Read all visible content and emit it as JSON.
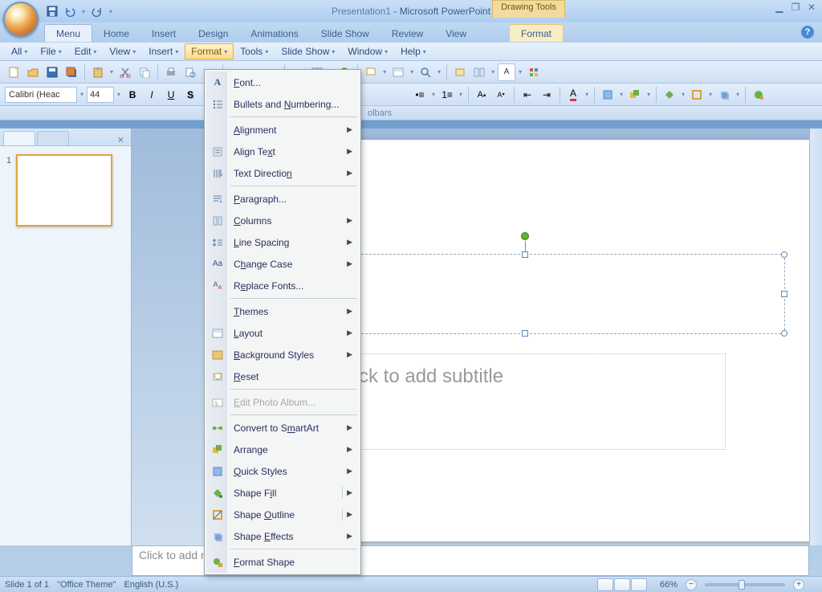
{
  "title": {
    "filename": "Presentation1",
    "app": "Microsoft PowerPoint",
    "context_tab": "Drawing Tools"
  },
  "ribbon_tabs": [
    "Menu",
    "Home",
    "Insert",
    "Design",
    "Animations",
    "Slide Show",
    "Review",
    "View"
  ],
  "ribbon_context_tab": "Format",
  "classic_menu": [
    "All",
    "File",
    "Edit",
    "View",
    "Insert",
    "Format",
    "Tools",
    "Slide Show",
    "Window",
    "Help"
  ],
  "classic_menu_open_index": 5,
  "font": {
    "name": "Calibri (Heac",
    "size": "44"
  },
  "toolbar_expand_label": "olbars",
  "format_menu": [
    {
      "label_html": "<u>F</u>ont...",
      "icon": "A",
      "type": "item"
    },
    {
      "label_html": "Bullets and <u>N</u>umbering...",
      "icon": "list",
      "type": "item"
    },
    {
      "type": "sep"
    },
    {
      "label_html": "<u>A</u>lignment",
      "icon": "",
      "type": "sub"
    },
    {
      "label_html": "Align Te<u>x</u>t",
      "icon": "align-text",
      "type": "sub"
    },
    {
      "label_html": "Text Directio<u>n</u>",
      "icon": "text-dir",
      "type": "sub"
    },
    {
      "type": "sep"
    },
    {
      "label_html": "<u>P</u>aragraph...",
      "icon": "para",
      "type": "item"
    },
    {
      "label_html": "<u>C</u>olumns",
      "icon": "cols",
      "type": "sub"
    },
    {
      "label_html": "<u>L</u>ine Spacing",
      "icon": "linesp",
      "type": "sub"
    },
    {
      "label_html": "C<u>h</u>ange Case",
      "icon": "Aa",
      "type": "sub"
    },
    {
      "label_html": "R<u>e</u>place Fonts...",
      "icon": "repfont",
      "type": "item"
    },
    {
      "type": "sep"
    },
    {
      "label_html": "<u>T</u>hemes",
      "icon": "",
      "type": "sub"
    },
    {
      "label_html": "<u>L</u>ayout",
      "icon": "layout",
      "type": "sub"
    },
    {
      "label_html": "<u>B</u>ackground Styles",
      "icon": "bg",
      "type": "sub"
    },
    {
      "label_html": "<u>R</u>eset",
      "icon": "reset",
      "type": "item"
    },
    {
      "type": "sep"
    },
    {
      "label_html": "<u>E</u>dit Photo Album...",
      "icon": "photo",
      "type": "item",
      "disabled": true
    },
    {
      "type": "sep"
    },
    {
      "label_html": "Convert to S<u>m</u>artArt",
      "icon": "smart",
      "type": "sub"
    },
    {
      "label_html": "Arran<u>g</u>e",
      "icon": "arrange",
      "type": "sub"
    },
    {
      "label_html": "<u>Q</u>uick Styles",
      "icon": "qstyle",
      "type": "sub"
    },
    {
      "label_html": "Shape F<u>i</u>ll",
      "icon": "fill",
      "type": "sub",
      "split": true
    },
    {
      "label_html": "Shape <u>O</u>utline",
      "icon": "outline",
      "type": "sub",
      "split": true
    },
    {
      "label_html": "Shape <u>E</u>ffects",
      "icon": "effects",
      "type": "sub"
    },
    {
      "type": "sep"
    },
    {
      "label_html": "<u>F</u>ormat Shape",
      "icon": "fmtshape",
      "type": "item"
    }
  ],
  "slide": {
    "subtitle_placeholder": "Click to add subtitle"
  },
  "notes_placeholder": "Click to add notes",
  "status": {
    "slide": "Slide 1 of 1",
    "theme": "\"Office Theme\"",
    "lang": "English (U.S.)",
    "zoom": "66%"
  },
  "thumb_number": "1"
}
